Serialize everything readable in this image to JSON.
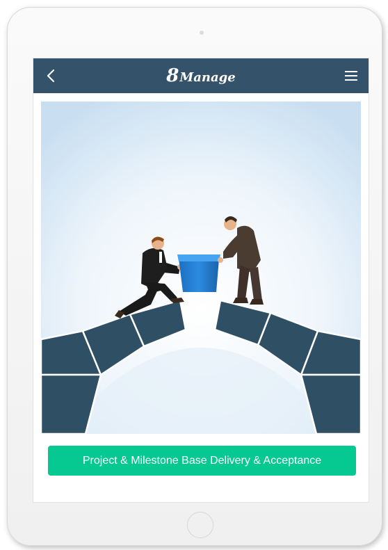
{
  "app": {
    "brand_number": "8",
    "brand_word": "Manage"
  },
  "navbar": {
    "back_icon": "chevron-left-icon",
    "menu_icon": "hamburger-menu-icon"
  },
  "illustration": {
    "icon": "bridge-handshake-illustration"
  },
  "cta": {
    "label": "Project & Milestone Base Delivery & Acceptance"
  },
  "colors": {
    "navbar": "#34536a",
    "cta": "#06c891",
    "bridge": "#2f5064",
    "sky": "#dbeaf6"
  }
}
